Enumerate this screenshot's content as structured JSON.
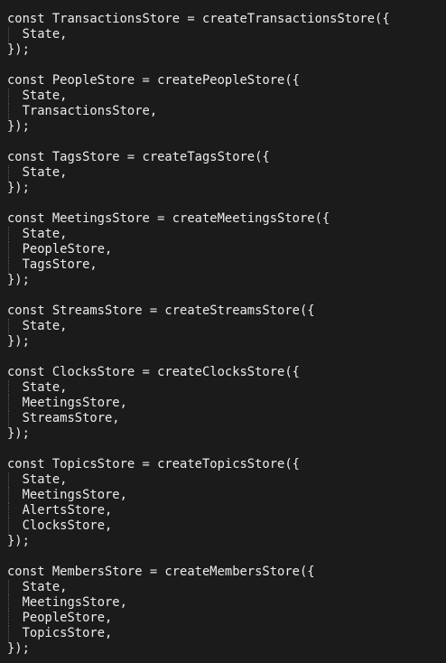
{
  "blocks": [
    {
      "head": "const TransactionsStore = createTransactionsStore({",
      "args": [
        "State,"
      ],
      "close": "});"
    },
    {
      "head": "const PeopleStore = createPeopleStore({",
      "args": [
        "State,",
        "TransactionsStore,"
      ],
      "close": "});"
    },
    {
      "head": "const TagsStore = createTagsStore({",
      "args": [
        "State,"
      ],
      "close": "});"
    },
    {
      "head": "const MeetingsStore = createMeetingsStore({",
      "args": [
        "State,",
        "PeopleStore,",
        "TagsStore,"
      ],
      "close": "});"
    },
    {
      "head": "const StreamsStore = createStreamsStore({",
      "args": [
        "State,"
      ],
      "close": "});"
    },
    {
      "head": "const ClocksStore = createClocksStore({",
      "args": [
        "State,",
        "MeetingsStore,",
        "StreamsStore,"
      ],
      "close": "});"
    },
    {
      "head": "const TopicsStore = createTopicsStore({",
      "args": [
        "State,",
        "MeetingsStore,",
        "AlertsStore,",
        "ClocksStore,"
      ],
      "close": "});"
    },
    {
      "head": "const MembersStore = createMembersStore({",
      "args": [
        "State,",
        "MeetingsStore,",
        "PeopleStore,",
        "TopicsStore,"
      ],
      "close": "});"
    }
  ]
}
